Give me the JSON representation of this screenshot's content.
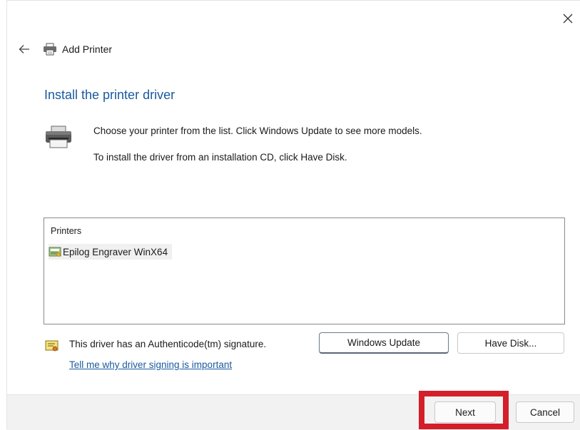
{
  "window": {
    "title": "Add Printer",
    "close_icon": "close-icon",
    "back_icon": "back-arrow-icon",
    "title_icon": "printer-icon"
  },
  "main": {
    "heading": "Install the printer driver",
    "instruction_1": "Choose your printer from the list. Click Windows Update to see more models.",
    "instruction_2": "To install the driver from an installation CD, click Have Disk.",
    "printer_icon": "printer-icon"
  },
  "printer_list": {
    "header": "Printers",
    "items": [
      {
        "label": "Epilog Engraver WinX64",
        "icon": "driver-icon",
        "selected": true
      }
    ]
  },
  "signature": {
    "icon": "certificate-icon",
    "text": "This driver has an Authenticode(tm) signature.",
    "link": "Tell me why driver signing is important"
  },
  "buttons": {
    "windows_update": "Windows Update",
    "have_disk": "Have Disk...",
    "next": "Next",
    "cancel": "Cancel"
  },
  "colors": {
    "accent": "#1a5aa0",
    "highlight": "#d41f2a"
  }
}
